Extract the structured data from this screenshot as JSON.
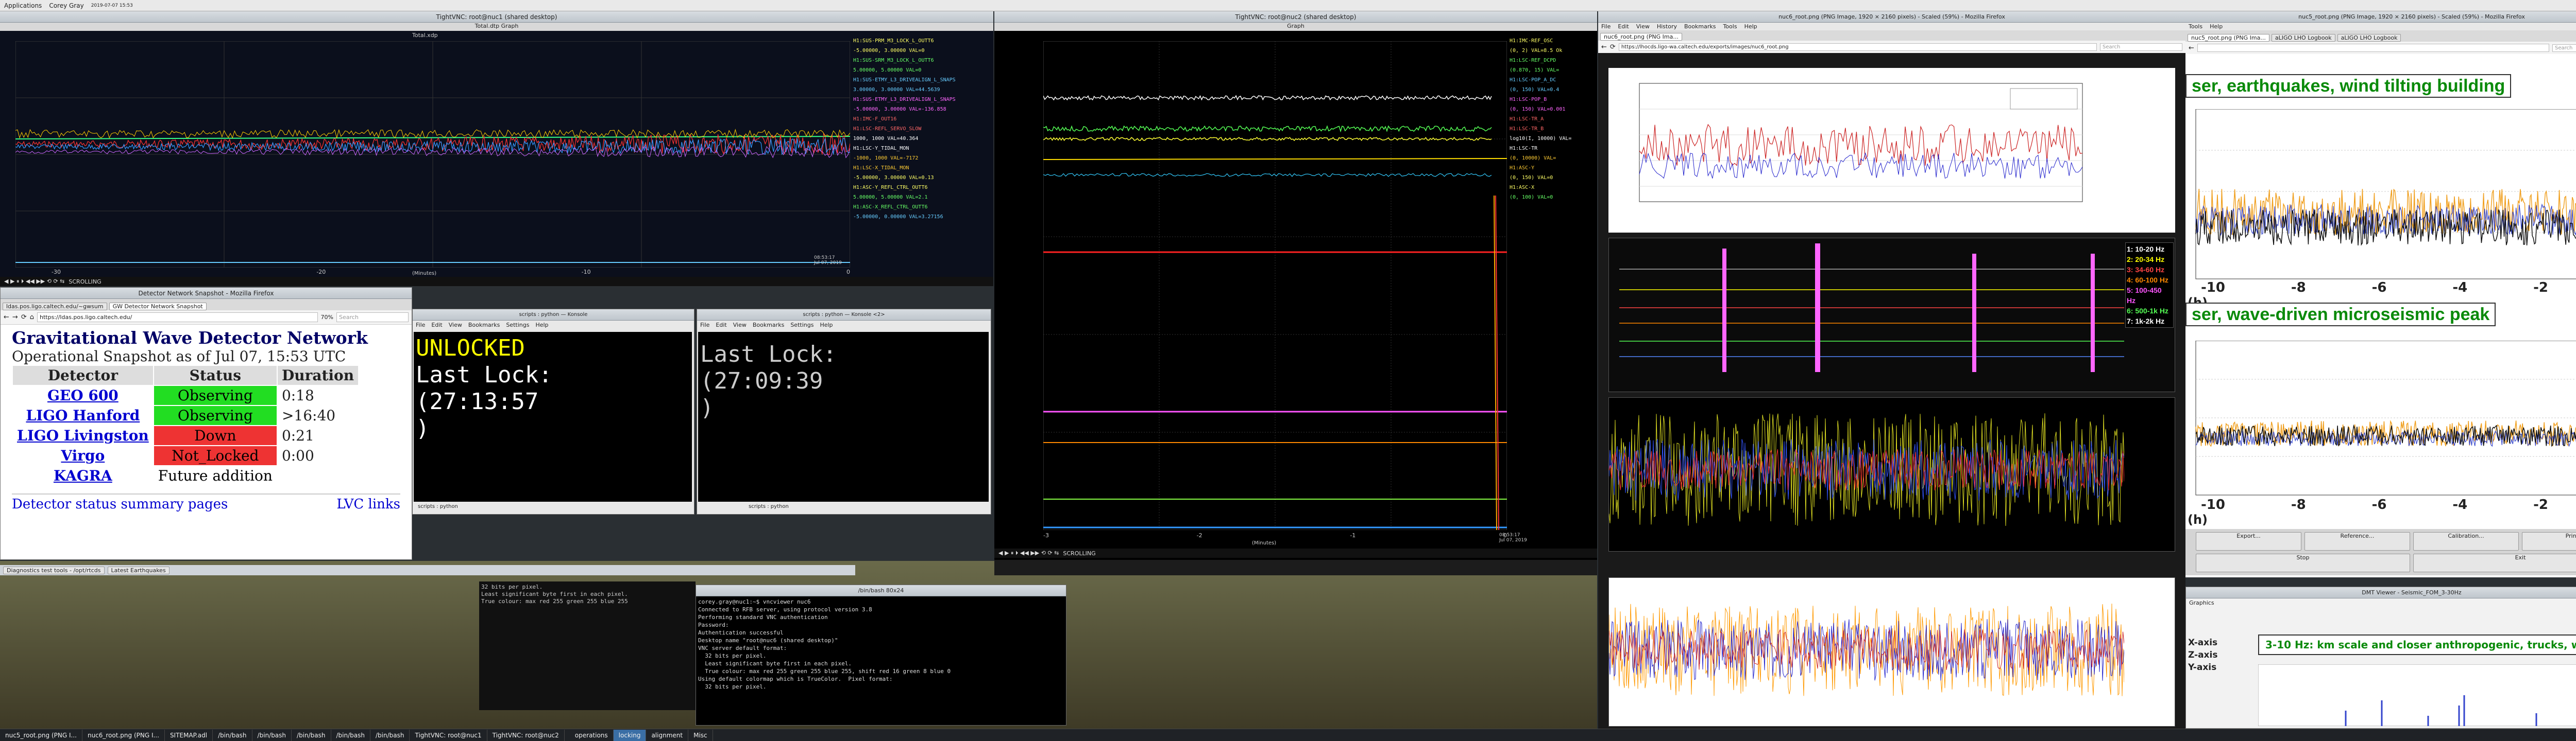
{
  "topbar": {
    "applications": "Applications",
    "user": "Corey Gray",
    "clock": "2019-07-07 15:53"
  },
  "vnc_left": {
    "title": "TightVNC: root@nuc1 (shared desktop)",
    "graph_title": "Total.dtp Graph",
    "plot_label": "Total.xdp",
    "xlabel": "(Minutes)",
    "timestamp": "08:53:17\nJul 07, 2019",
    "xticks": [
      "-30",
      "-20",
      "-10",
      "0"
    ],
    "scroll": "SCROLLING",
    "legend": [
      "H1:SUS-PRM_M3_LOCK_L_OUTT6",
      "-5.00000, 3.00000 VAL=0",
      "H1:SUS-SRM_M3_LOCK_L_OUTT6",
      "5.00000, 5.00000 VAL=0",
      "H1:SUS-ETMY_L3_DRIVEALIGN_L_SNAPS",
      "3.00000, 3.00000 VAL=44.5639",
      "H1:SUS-ETMY_L3_DRIVEALIGN_L_SNAPS",
      "-5.00000, 3.00000 VAL=-136.858",
      "H1:IMC-F_OUT16",
      "H1:LSC-REFL_SERVO_SLOW",
      "1000, 1000 VAL=40.364",
      "H1:LSC-Y_TIDAL_MON",
      "-1000, 1000 VAL=-7172",
      "H1:LSC-X_TIDAL_MON",
      "-5.00000, 3.00000 VAL=0.13",
      "H1:ASC-Y_REFL_CTRL_OUTT6",
      "5.00000, 5.00000 VAL=2.1",
      "H1:ASC-X_REFL_CTRL_OUTT6",
      "-5.00000, 0.00000 VAL=3.27156"
    ]
  },
  "browser_left": {
    "title": "Detector Network Snapshot - Mozilla Firefox",
    "tab1": "ldas.pos.ligo.caltech.edu/~gwsum",
    "tab2": "GW Detector Network Snapshot",
    "url": "https://ldas.pos.ligo.caltech.edu/",
    "zoom": "70%",
    "search": "Search",
    "heading": "Gravitational Wave Detector Network",
    "subheading": "Operational Snapshot as of Jul 07, 15:53 UTC",
    "cols": [
      "Detector",
      "Status",
      "Duration"
    ],
    "rows": [
      {
        "name": "GEO 600",
        "status": "Observing",
        "dur": "0:18",
        "color": "#22dd22"
      },
      {
        "name": "LIGO Hanford",
        "status": "Observing",
        "dur": ">16:40",
        "color": "#22dd22"
      },
      {
        "name": "LIGO Livingston",
        "status": "Down",
        "dur": "0:21",
        "color": "#ee3333"
      },
      {
        "name": "Virgo",
        "status": "Not_Locked",
        "dur": "0:00",
        "color": "#ee3333"
      },
      {
        "name": "KAGRA",
        "status": "Future addition",
        "dur": "",
        "color": "#ffffff"
      }
    ],
    "link1": "Detector status summary pages",
    "link2": "LVC links"
  },
  "konsole1": {
    "title": "scripts : python — Konsole",
    "menu": [
      "File",
      "Edit",
      "View",
      "Bookmarks",
      "Settings",
      "Help"
    ],
    "line1": "UNLOCKED",
    "line2": "Last Lock:",
    "line3": "(27:13:57",
    "line4": ")",
    "tab": "scripts : python"
  },
  "konsole2": {
    "title": "scripts : python — Konsole <2>",
    "menu": [
      "File",
      "Edit",
      "View",
      "Bookmarks",
      "Settings",
      "Help"
    ],
    "line1": "Last Lock:",
    "line2": "(27:09:39",
    "line3": ")",
    "tab": "scripts : python"
  },
  "vnc_mid": {
    "title": "TightVNC: root@nuc2 (shared desktop)",
    "graph_title": "Graph",
    "xlabel": "(Minutes)",
    "timestamp": "08:53:17\nJul 07, 2019",
    "xticks": [
      "-3",
      "-2",
      "-1",
      "0"
    ],
    "scroll": "SCROLLING",
    "legend": [
      "H1:IMC-REF_OSC",
      "(0, 2) VAL=8.5 Ok",
      "H1:LSC-REF_DCPD",
      "(0.870, 15) VAL=",
      "H1:LSC-POP_A_DC",
      "(0, 150) VAL=0.4",
      "H1:LSC-POP_B",
      "(0, 150) VAL=0.001",
      "H1:LSC-TR_A",
      "H1:LSC-TR_B",
      "log10(I, 10000) VAL=",
      "H1:LSC-TR",
      "(0, 10000) VAL=",
      "H1:ASC-Y",
      "(0, 150) VAL=0",
      "H1:ASC-X",
      "(0, 100) VAL=0"
    ]
  },
  "ff_right1": {
    "title": "nuc6_root.png (PNG Image, 1920 × 2160 pixels) - Scaled (59%) - Mozilla Firefox",
    "menu": [
      "File",
      "Edit",
      "View",
      "History",
      "Bookmarks",
      "Tools",
      "Help"
    ],
    "tab": "nuc6_root.png (PNG Ima...",
    "url": "https://lhocds.ligo-wa.caltech.edu/exports/images/nuc6_root.png",
    "search": "Search"
  },
  "ff_right2": {
    "title": "nuc5_root.png (PNG Image, 1920 × 2160 pixels) - Scaled (59%) - Mozilla Firefox",
    "menu": [
      "Tools",
      "Help"
    ],
    "tab1": "nuc5_root.png (PNG Ima...",
    "tab2": "aLIGO LHO Logbook",
    "tab3": "aLIGO LHO Logbook",
    "search": "Search",
    "title1": "ser, earthquakes, wind tilting building",
    "title2": "ser, wave-driven microseismic peak",
    "xticks": [
      "-10",
      "-8",
      "-6",
      "-4",
      "-2",
      "0"
    ],
    "xunit": "(h)",
    "buttons": [
      "Stop",
      "Exit",
      "Export...",
      "Reference...",
      "Calibration...",
      "Print..."
    ]
  },
  "bands": [
    "1: 10-20 Hz",
    "2: 20-34 Hz",
    "3: 34-60 Hz",
    "4: 60-100 Hz",
    "5: 100-450 Hz",
    "6: 500-1k Hz",
    "7: 1k-2k Hz"
  ],
  "band_colors": [
    "#ffffff",
    "#ffff00",
    "#ff4444",
    "#ff8800",
    "#ff55ff",
    "#55ff55",
    "#ffffff"
  ],
  "dmt": {
    "title": "DMT Viewer - Seismic_FOM_3-30Hz",
    "title_in": "3-10 Hz: km scale and closer anthropogenic, trucks, wind",
    "axes": [
      "X-axis",
      "Z-axis",
      "Y-axis"
    ],
    "menu": "Graphics"
  },
  "terminal": {
    "title": "/bin/bash 80x24",
    "lines": [
      "corey.gray@nuc1:~$ vncviewer nuc6",
      "Connected to RFB server, using protocol version 3.8",
      "Performing standard VNC authentication",
      "Password:",
      "Authentication successful",
      "Desktop name \"root@nuc6 (shared desktop)\"",
      "VNC server default format:",
      "  32 bits per pixel.",
      "  Least significant byte first in each pixel.",
      "  True colour: max red 255 green 255 blue 255, shift red 16 green 8 blue 0",
      "Using default colormap which is TrueColor.  Pixel format:",
      "  32 bits per pixel."
    ]
  },
  "terminal_small": {
    "lines": [
      "32 bits per pixel.",
      "Least significant byte first in each pixel.",
      "True colour: max red 255 green 255 blue 255"
    ]
  },
  "diag_tabs": [
    "Diagnostics test tools - /opt/rtcds",
    "Latest Earthquakes",
    "Graph"
  ],
  "taskbar": [
    "nuc5_root.png (PNG I...",
    "nuc6_root.png (PNG I...",
    "SITEMAP.adl",
    "/bin/bash",
    "/bin/bash",
    "/bin/bash",
    "/bin/bash",
    "/bin/bash",
    "TightVNC: root@nuc1",
    "TightVNC: root@nuc2"
  ],
  "workspaces": [
    "operations",
    "locking",
    "alignment",
    "Misc"
  ]
}
